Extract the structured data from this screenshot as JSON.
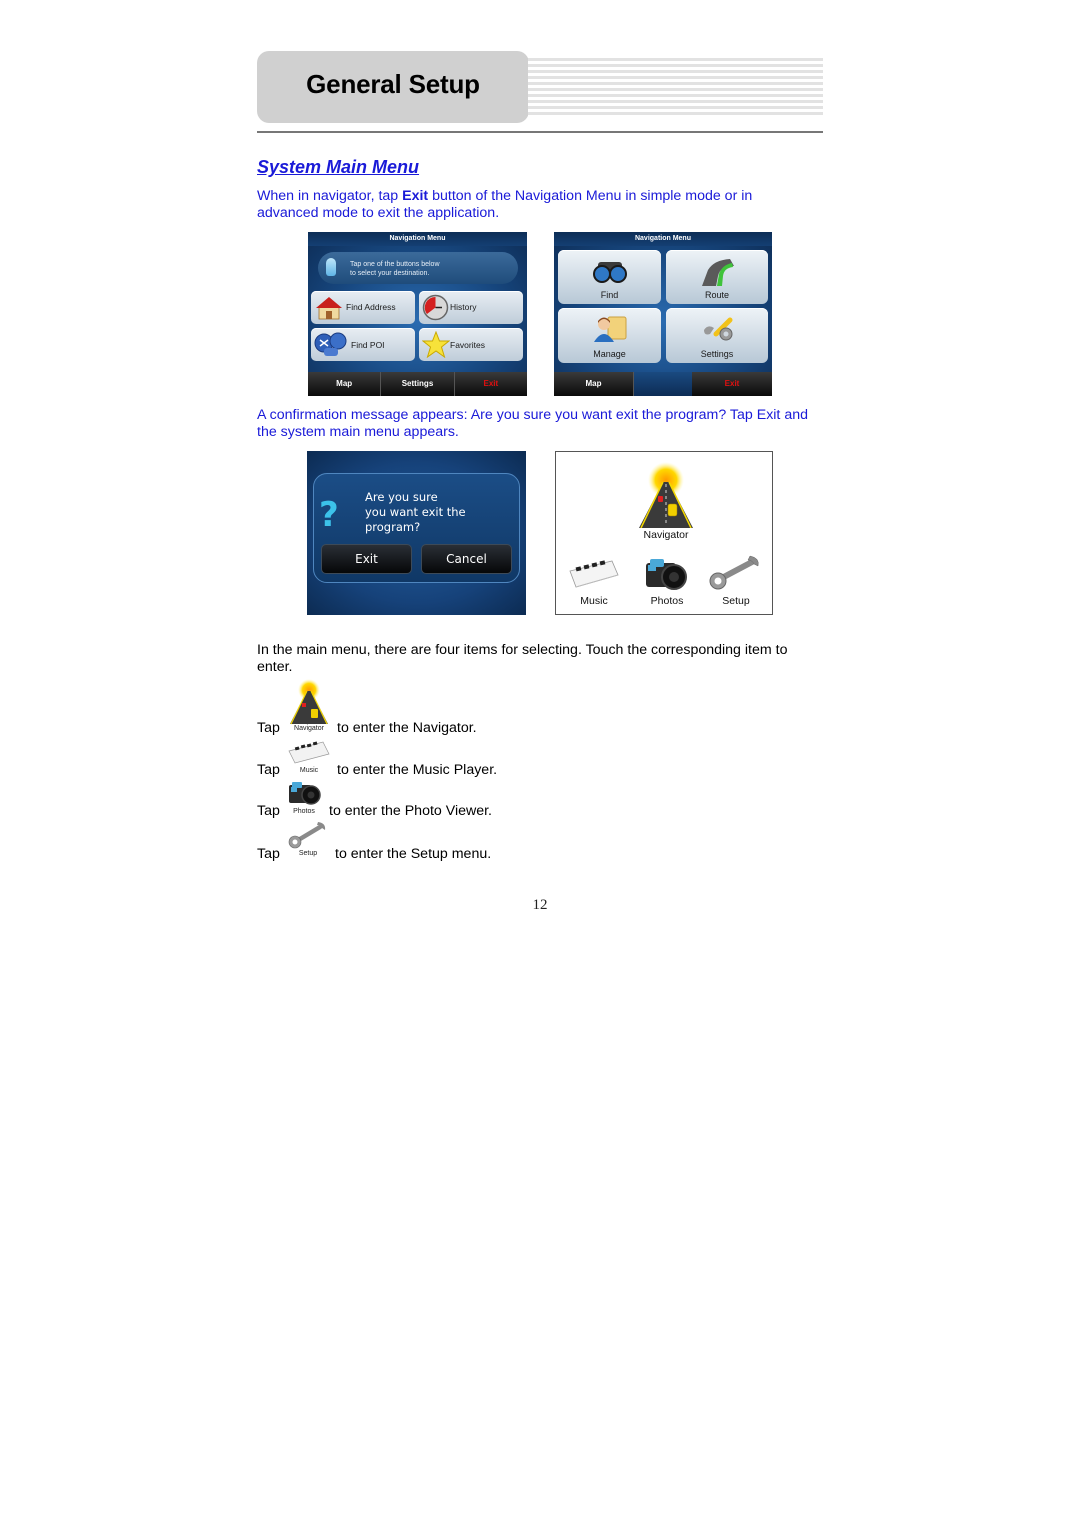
{
  "header": {
    "title": "General Setup"
  },
  "section": {
    "title": "System Main Menu"
  },
  "intro": {
    "before_bold": "When in navigator, tap ",
    "bold": "Exit",
    "after_bold_line1": " button of the Navigation Menu in simple mode or in",
    "line2": "advanced mode to exit the application."
  },
  "nav_simple": {
    "title": "Navigation Menu",
    "hint_line1": "Tap one of the buttons below",
    "hint_line2": "to select your destination.",
    "buttons": [
      {
        "label": "Find Address",
        "icon": "house-icon"
      },
      {
        "label": "History",
        "icon": "clock-icon"
      },
      {
        "label": "Find POI",
        "icon": "poi-icon"
      },
      {
        "label": "Favorites",
        "icon": "star-icon"
      }
    ],
    "bottom": [
      "Map",
      "Settings",
      "Exit"
    ]
  },
  "nav_advanced": {
    "title": "Navigation Menu",
    "buttons": [
      {
        "label": "Find",
        "icon": "binoculars-icon"
      },
      {
        "label": "Route",
        "icon": "road-icon"
      },
      {
        "label": "Manage",
        "icon": "user-folder-icon"
      },
      {
        "label": "Settings",
        "icon": "wrench-nut-icon"
      }
    ],
    "bottom": [
      "Map",
      "Exit"
    ]
  },
  "confirm_para": {
    "line1": "A confirmation message appears: Are you sure you want exit the program? Tap Exit and",
    "line2": "the system main menu appears."
  },
  "dialog": {
    "line1": "Are you sure",
    "line2": "you want exit the",
    "line3": "program?",
    "exit_label": "Exit",
    "cancel_label": "Cancel"
  },
  "main_menu": {
    "items": [
      {
        "label": "Navigator",
        "icon": "navigator-road-icon"
      },
      {
        "label": "Music",
        "icon": "piano-keyboard-icon"
      },
      {
        "label": "Photos",
        "icon": "camera-icon"
      },
      {
        "label": "Setup",
        "icon": "wrench-icon"
      }
    ]
  },
  "menu_para": {
    "line1": "In the main menu, there are four items for selecting. Touch the corresponding item to",
    "line2": "enter."
  },
  "taps": [
    {
      "prefix": "Tap",
      "icon_label": "Navigator",
      "text": "to enter the Navigator."
    },
    {
      "prefix": "Tap",
      "icon_label": "Music",
      "text": "to enter the Music Player."
    },
    {
      "prefix": "Tap",
      "icon_label": "Photos",
      "text": "to enter the Photo Viewer."
    },
    {
      "prefix": "Tap",
      "icon_label": "Setup",
      "text": "to enter the Setup menu."
    }
  ],
  "page_number": "12"
}
